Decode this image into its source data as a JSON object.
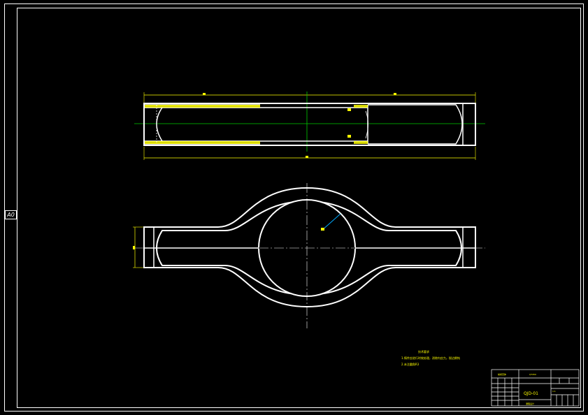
{
  "sheet": {
    "size_code": "A0"
  },
  "notes": {
    "title": "技术要求",
    "lines": [
      "1.铸件应进行时效处理，消除内应力，锐边倒钝",
      "2.未注圆角R3"
    ]
  },
  "title_block": {
    "drawing_number": "QJD-01",
    "part_name": "前桥壳体",
    "material": "QT450",
    "scale": "1:1",
    "company": "课程设计"
  },
  "colors": {
    "outline": "#ffffff",
    "dimension": "#ffff00",
    "centerline": "#00cc00",
    "leader": "#00aaff"
  }
}
